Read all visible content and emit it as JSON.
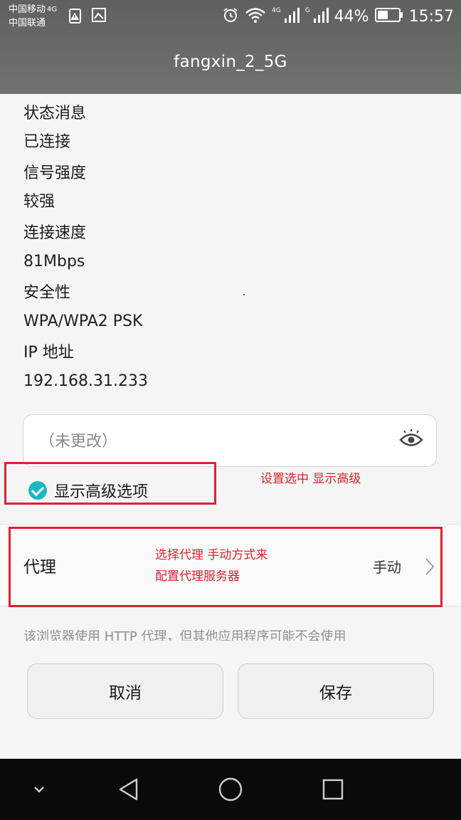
{
  "status_bar": {
    "carrier1": "中国移动",
    "carrier1_net": "4G",
    "carrier2": "中国联通",
    "net_tag1": "4G",
    "net_tag2": "G",
    "battery": "44%",
    "time": "15:57"
  },
  "title": "fangxin_2_5G",
  "info": [
    {
      "label": "状态消息",
      "value": "已连接"
    },
    {
      "label": "信号强度",
      "value": "较强"
    },
    {
      "label": "连接速度",
      "value": "81Mbps"
    },
    {
      "label": "安全性",
      "value": "WPA/WPA2 PSK"
    },
    {
      "label": "IP 地址",
      "value": "192.168.31.233"
    }
  ],
  "password": {
    "placeholder": "（未更改）"
  },
  "advanced": {
    "label": "显示高级选项",
    "checked": true
  },
  "annotation_advanced": "设置选中 显示高级",
  "proxy": {
    "label": "代理",
    "value": "手动",
    "annotation_line1": "选择代理 手动方式来",
    "annotation_line2": "配置代理服务器"
  },
  "note": "该浏览器使用 HTTP 代理，但其他应用程序可能不会使用",
  "buttons": {
    "cancel": "取消",
    "save": "保存"
  },
  "colors": {
    "accent": "#1bb6c4",
    "annotation": "#e02030"
  }
}
